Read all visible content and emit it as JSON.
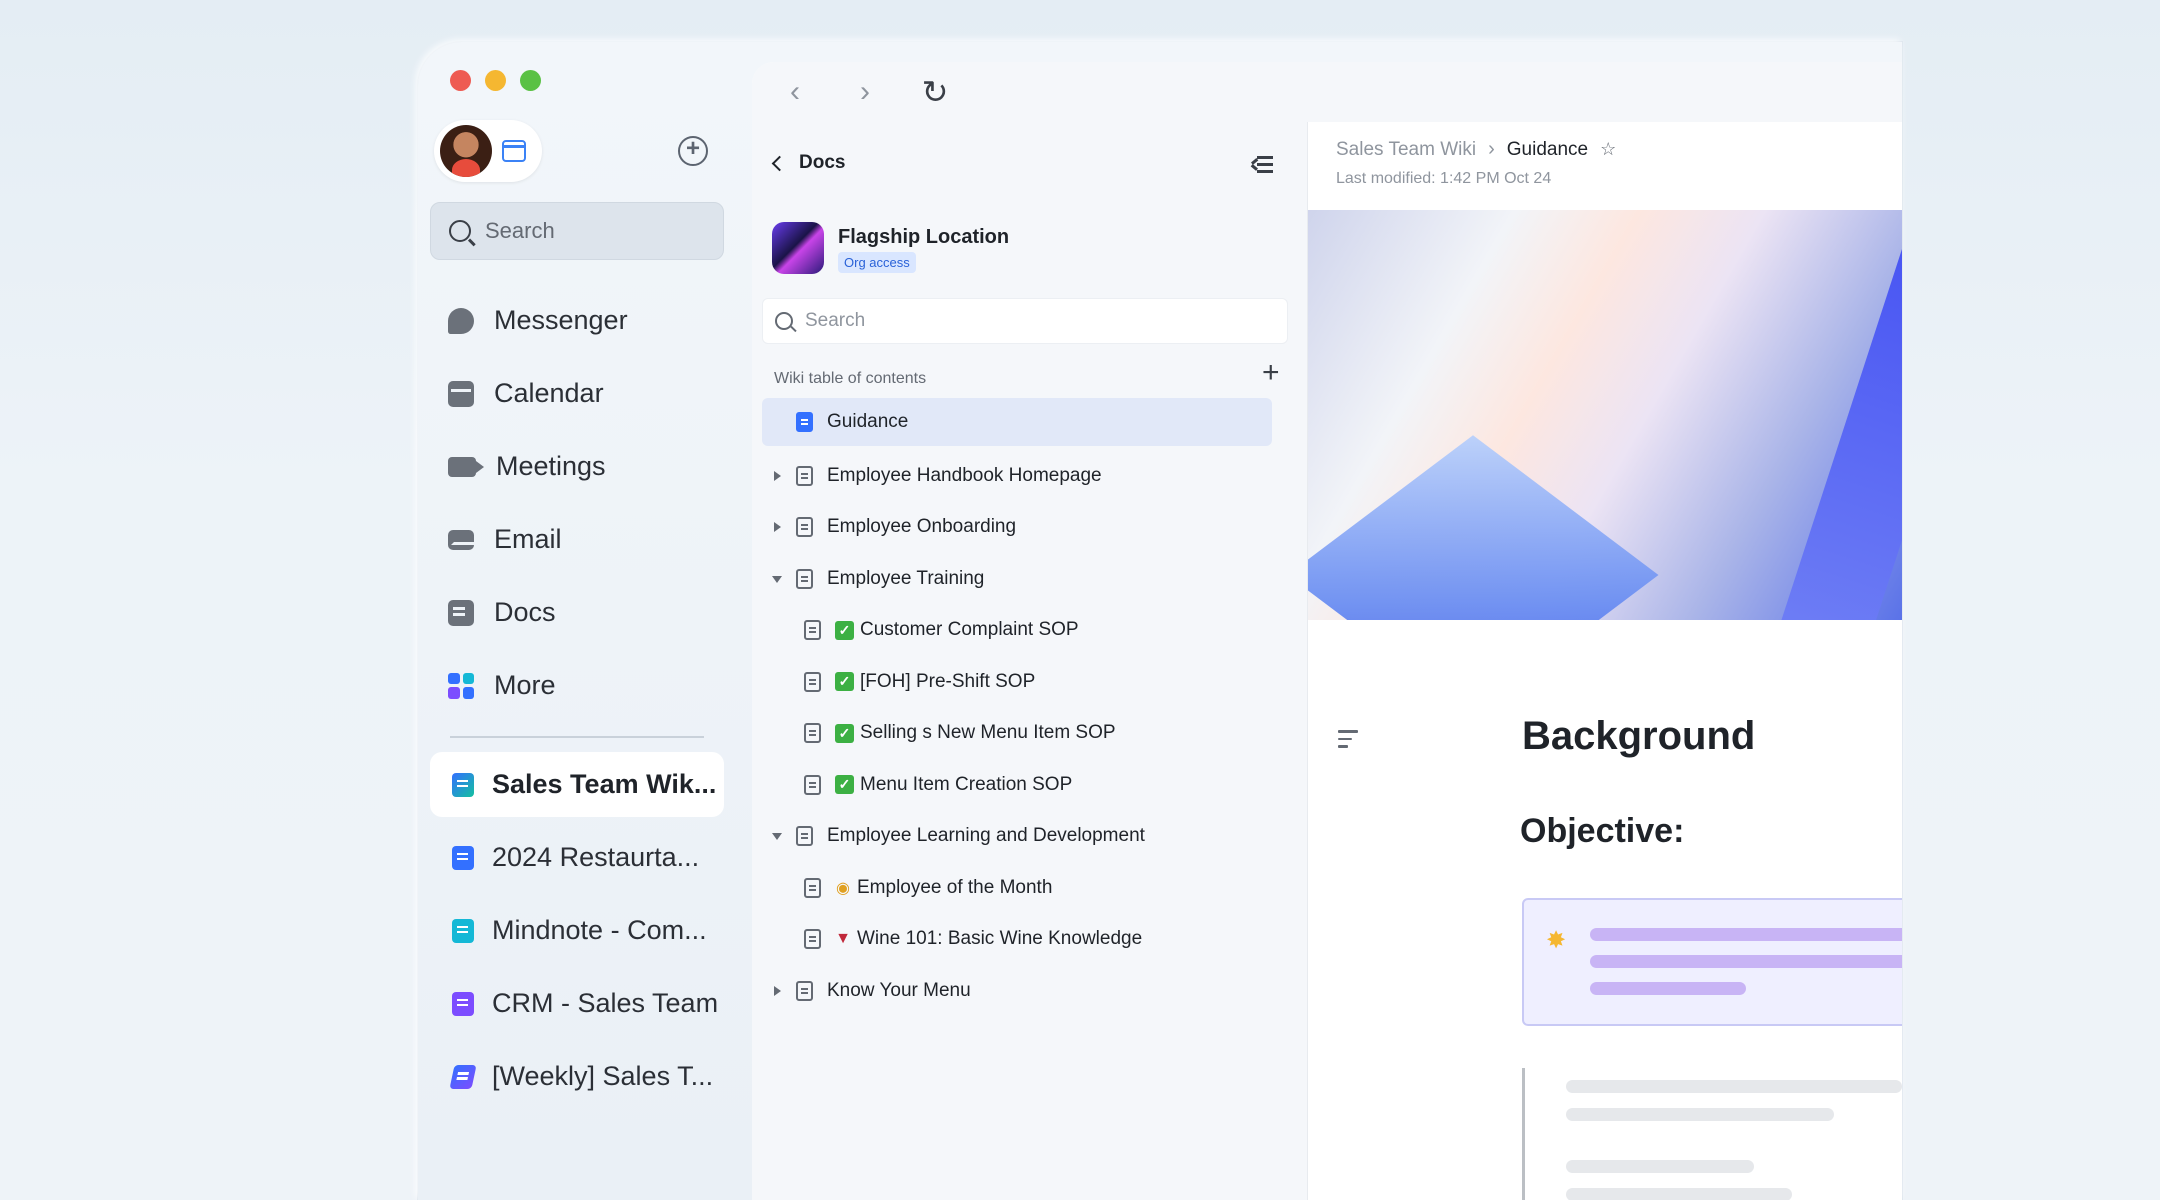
{
  "sidebar": {
    "search_placeholder": "Search",
    "nav": [
      {
        "label": "Messenger",
        "icon": "messenger-icon"
      },
      {
        "label": "Calendar",
        "icon": "calendar-icon"
      },
      {
        "label": "Meetings",
        "icon": "video-icon"
      },
      {
        "label": "Email",
        "icon": "email-icon"
      },
      {
        "label": "Docs",
        "icon": "docs-icon"
      },
      {
        "label": "More",
        "icon": "more-icon"
      }
    ],
    "favorites": [
      {
        "label": "Sales Team Wik...",
        "icon": "wiki-icon",
        "color": "#3370ff",
        "active": true
      },
      {
        "label": "2024 Restaurta...",
        "icon": "doc-icon",
        "color": "#3370ff"
      },
      {
        "label": "Mindnote - Com...",
        "icon": "mindnote-icon",
        "color": "#14b8d6"
      },
      {
        "label": "CRM - Sales Team",
        "icon": "base-icon",
        "color": "#7c4dff"
      },
      {
        "label": "[Weekly] Sales T...",
        "icon": "slides-icon",
        "color": "#3370ff"
      }
    ]
  },
  "docs": {
    "back_label": "Docs",
    "space_name": "Flagship Location",
    "space_badge": "Org access",
    "search_placeholder": "Search",
    "toc_heading": "Wiki table of contents",
    "toc": [
      {
        "label": "Guidance",
        "level": 0,
        "caret": "none",
        "selected": true
      },
      {
        "label": "Employee Handbook Homepage",
        "level": 0,
        "caret": "right"
      },
      {
        "label": "Employee Onboarding",
        "level": 0,
        "caret": "right"
      },
      {
        "label": "Employee Training",
        "level": 0,
        "caret": "down"
      },
      {
        "label": "Customer Complaint SOP",
        "level": 1,
        "prefix": "check"
      },
      {
        "label": "[FOH] Pre-Shift SOP",
        "level": 1,
        "prefix": "check"
      },
      {
        "label": "Selling s New Menu Item SOP",
        "level": 1,
        "prefix": "check"
      },
      {
        "label": "Menu Item Creation SOP",
        "level": 1,
        "prefix": "check"
      },
      {
        "label": "Employee Learning and Development",
        "level": 0,
        "caret": "down"
      },
      {
        "label": "Employee of the Month",
        "level": 1,
        "prefix": "medal"
      },
      {
        "label": "Wine 101: Basic Wine Knowledge",
        "level": 1,
        "prefix": "wine"
      },
      {
        "label": "Know Your Menu",
        "level": 0,
        "caret": "right"
      }
    ]
  },
  "content": {
    "breadcrumb_parent": "Sales Team Wiki",
    "breadcrumb_current": "Guidance",
    "last_modified": "Last modified: 1:42 PM Oct 24",
    "heading": "Background",
    "subheading": "Objective:"
  }
}
